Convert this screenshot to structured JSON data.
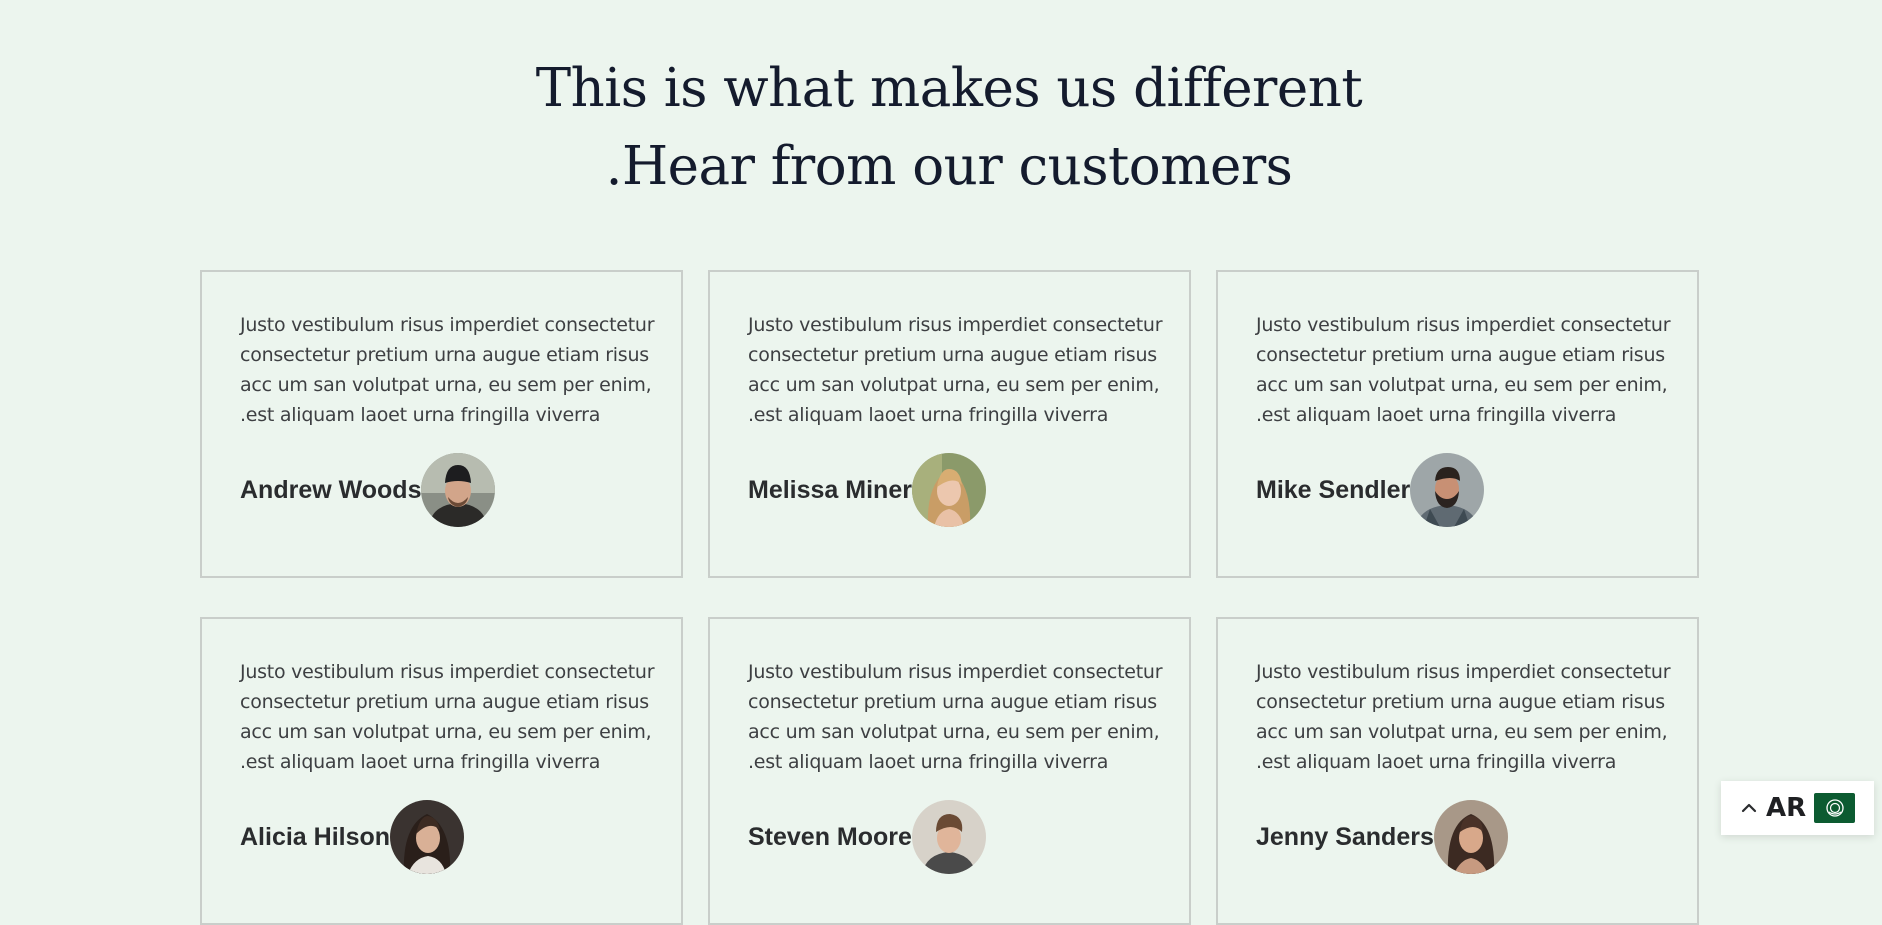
{
  "section": {
    "heading_line1": "This is what makes us different",
    "heading_line2": ".Hear from our customers"
  },
  "testimonials": [
    {
      "quote": "Justo vestibulum risus imperdiet consectetur consectetur pretium urna augue etiam risus acc um san volutpat urna, eu sem per enim, .est aliquam laoet urna fringilla viverra",
      "name": "Andrew Woods",
      "avatar": "man-beanie-avatar"
    },
    {
      "quote": "Justo vestibulum risus imperdiet consectetur consectetur pretium urna augue etiam risus acc um san volutpat urna, eu sem per enim, .est aliquam laoet urna fringilla viverra",
      "name": "Melissa Miner",
      "avatar": "woman-blonde-avatar"
    },
    {
      "quote": "Justo vestibulum risus imperdiet consectetur consectetur pretium urna augue etiam risus acc um san volutpat urna, eu sem per enim, .est aliquam laoet urna fringilla viverra",
      "name": "Mike Sendler",
      "avatar": "man-beard-avatar"
    },
    {
      "quote": "Justo vestibulum risus imperdiet consectetur consectetur pretium urna augue etiam risus acc um san volutpat urna, eu sem per enim, .est aliquam laoet urna fringilla viverra",
      "name": "Alicia Hilson",
      "avatar": "woman-dark-hair-avatar"
    },
    {
      "quote": "Justo vestibulum risus imperdiet consectetur consectetur pretium urna augue etiam risus acc um san volutpat urna, eu sem per enim, .est aliquam laoet urna fringilla viverra",
      "name": "Steven Moore",
      "avatar": "man-young-avatar"
    },
    {
      "quote": "Justo vestibulum risus imperdiet consectetur consectetur pretium urna augue etiam risus acc um san volutpat urna, eu sem per enim, .est aliquam laoet urna fringilla viverra",
      "name": "Jenny Sanders",
      "avatar": "woman-brunette-avatar"
    }
  ],
  "language_switcher": {
    "code": "AR",
    "icon": "chevron-up-icon",
    "flag": "arab-league-flag-icon"
  },
  "colors": {
    "background": "#ecf5ee",
    "heading": "#141b2d",
    "card_border": "#c9ceca",
    "flag_green": "#0c5b31"
  }
}
